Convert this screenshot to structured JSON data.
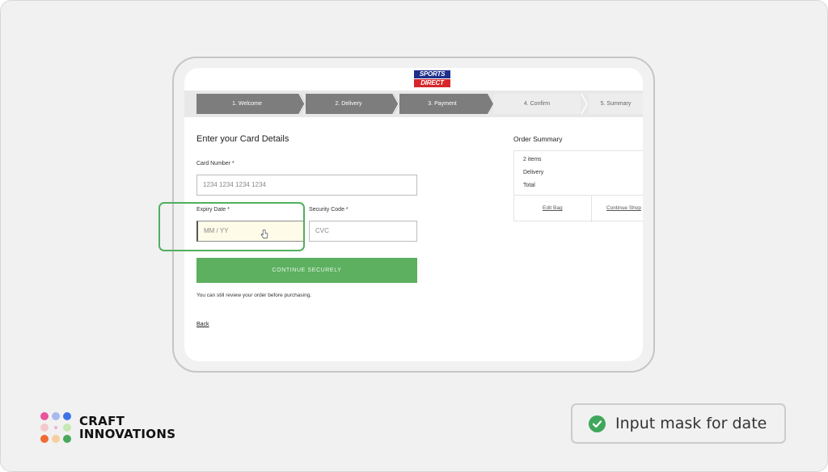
{
  "logo": {
    "line1": "SPORTS",
    "line2": "DIRECT"
  },
  "steps": [
    {
      "label": "1. Welcome",
      "status": "done"
    },
    {
      "label": "2. Delivery",
      "status": "done"
    },
    {
      "label": "3. Payment",
      "status": "done"
    },
    {
      "label": "4. Confirm",
      "status": "todo"
    },
    {
      "label": "5. Summary",
      "status": "todo"
    }
  ],
  "form": {
    "title": "Enter your Card Details",
    "card_number_label": "Card Number *",
    "card_number_placeholder": "1234 1234 1234 1234",
    "expiry_label": "Expiry Date *",
    "expiry_placeholder": "MM / YY",
    "security_label": "Security Code *",
    "security_placeholder": "CVC",
    "continue_label": "CONTINUE SECURELY",
    "note": "You can still review your order before purchasing.",
    "back_label": "Back"
  },
  "order_summary": {
    "title": "Order Summary",
    "lines": [
      "2 items",
      "Delivery",
      "Total"
    ],
    "edit_bag": "Edit Bag",
    "continue_shopping": "Continue Shop"
  },
  "brand": {
    "line1": "CRAFT",
    "line2": "INNOVATIONS"
  },
  "badge": {
    "text": "Input mask for date"
  },
  "colors": {
    "accent_green": "#5cb05f",
    "highlight_green": "#4fb05e",
    "logo_blue": "#1f2f8c",
    "logo_red": "#d6262b"
  }
}
